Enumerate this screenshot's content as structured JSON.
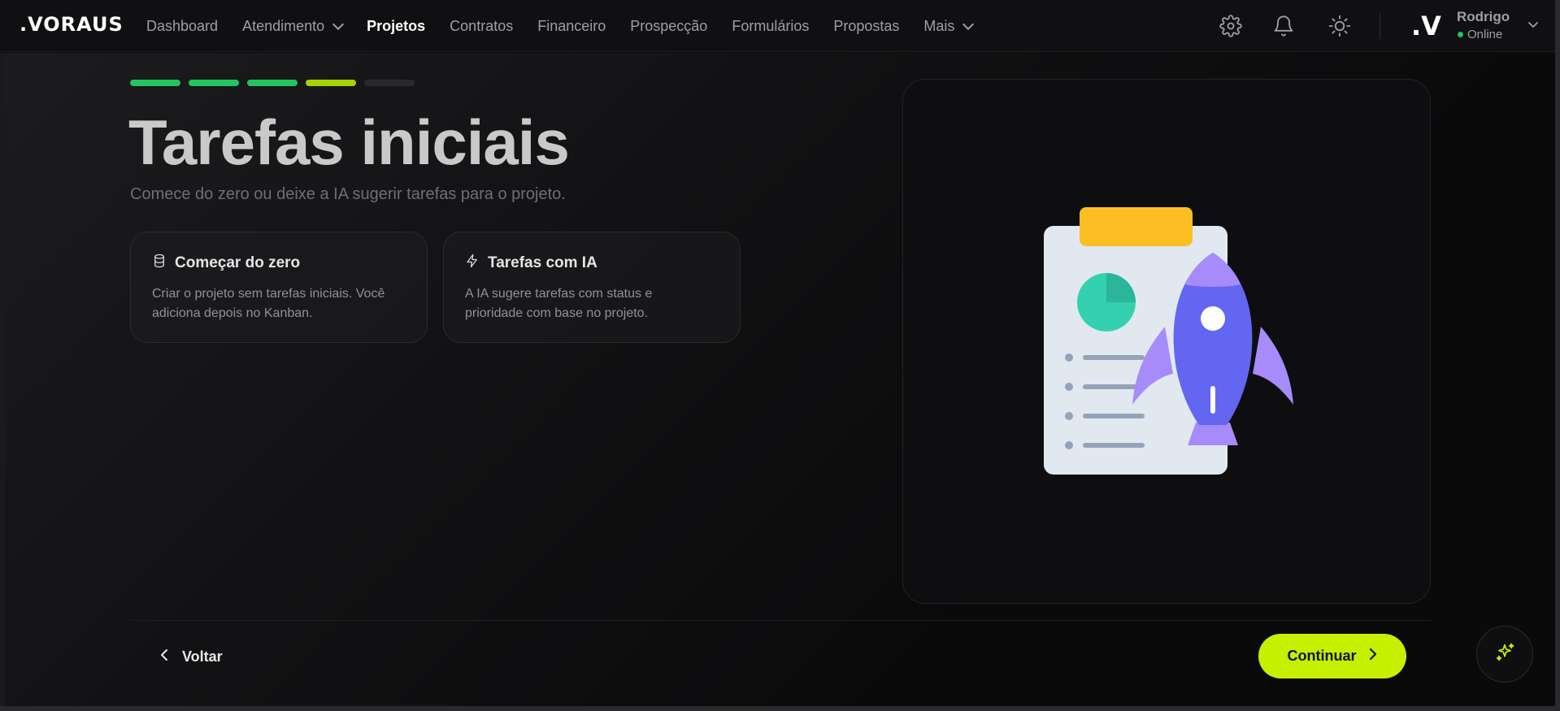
{
  "app": {
    "logo": ".VORAUS"
  },
  "nav": {
    "items": [
      {
        "label": "Dashboard",
        "active": false,
        "dropdown": false
      },
      {
        "label": "Atendimento",
        "active": false,
        "dropdown": true
      },
      {
        "label": "Projetos",
        "active": true,
        "dropdown": false
      },
      {
        "label": "Contratos",
        "active": false,
        "dropdown": false
      },
      {
        "label": "Financeiro",
        "active": false,
        "dropdown": false
      },
      {
        "label": "Prospecção",
        "active": false,
        "dropdown": false
      },
      {
        "label": "Formulários",
        "active": false,
        "dropdown": false
      },
      {
        "label": "Propostas",
        "active": false,
        "dropdown": false
      },
      {
        "label": "Mais",
        "active": false,
        "dropdown": true
      }
    ],
    "icons": [
      "gear-icon",
      "bell-icon",
      "sun-icon"
    ]
  },
  "user": {
    "avatar_text": ".V",
    "name": "Rodrigo",
    "status": "Online",
    "status_color": "#22c55e"
  },
  "wizard": {
    "steps": [
      {
        "state": "done",
        "color": "#22c55e"
      },
      {
        "state": "done",
        "color": "#22c55e"
      },
      {
        "state": "done",
        "color": "#22c55e"
      },
      {
        "state": "current",
        "color": "#a3d400"
      },
      {
        "state": "pending",
        "color": "#2a2a2e"
      }
    ],
    "title": "Tarefas iniciais",
    "subtitle": "Comece do zero ou deixe a IA sugerir tarefas para o projeto.",
    "options": [
      {
        "icon": "database-icon",
        "title": "Começar do zero",
        "description": "Criar o projeto sem tarefas iniciais. Você adiciona depois no Kanban."
      },
      {
        "icon": "lightning-icon",
        "title": "Tarefas com IA",
        "description": "A IA sugere tarefas com status e prioridade com base no projeto."
      }
    ]
  },
  "footer": {
    "back_label": "Voltar",
    "continue_label": "Continuar",
    "accent_color": "#c6f000"
  }
}
